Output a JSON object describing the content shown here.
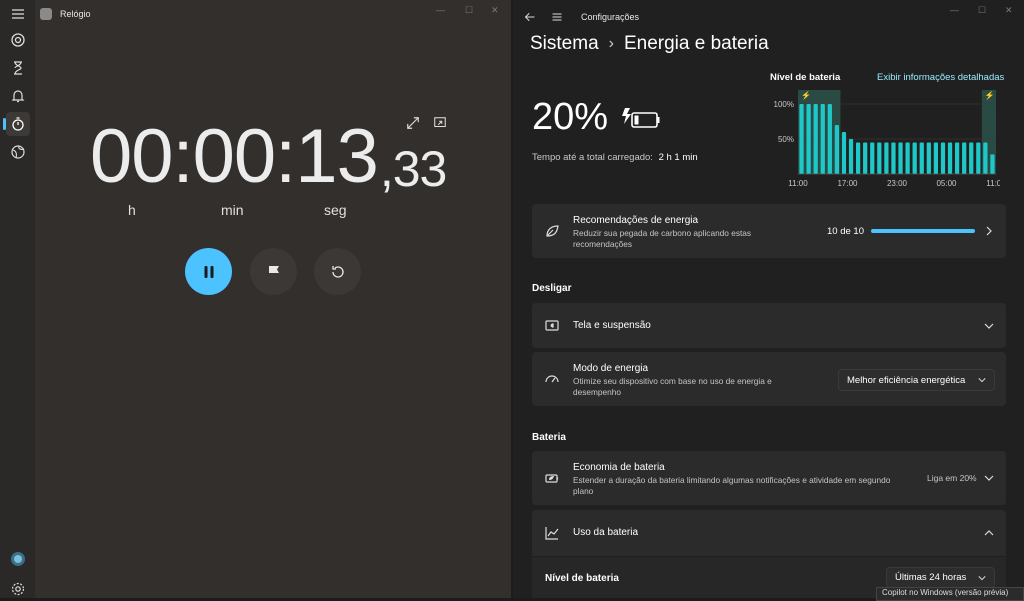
{
  "clock": {
    "title": "Relógio",
    "timer": {
      "main": "00:00:13",
      "centiseconds": ",33"
    },
    "units": {
      "hours": "h",
      "minutes": "min",
      "seconds": "seg"
    },
    "nav_icons": [
      "menu-icon",
      "focus-icon",
      "timer-icon",
      "alarm-icon",
      "stopwatch-icon",
      "world-clock-icon",
      "avatar-icon",
      "settings-icon"
    ]
  },
  "settings": {
    "title": "Configurações",
    "breadcrumb": {
      "parent": "Sistema",
      "current": "Energia e bateria"
    },
    "battery": {
      "percent": "20%",
      "time_full_label": "Tempo até a total carregado:",
      "time_full_value": "2 h 1 min"
    },
    "level_panel": {
      "title": "Nível de bateria",
      "details_link": "Exibir informações detalhadas"
    },
    "recommendations": {
      "title": "Recomendações de energia",
      "desc": "Reduzir sua pegada de carbono aplicando estas recomendações",
      "count": "10 de 10",
      "progress": 1.0
    },
    "desligar": {
      "header": "Desligar",
      "screen_sleep": "Tela e suspensão",
      "power_mode_title": "Modo de energia",
      "power_mode_desc": "Otimize seu dispositivo com base no uso de energia e desempenho",
      "power_mode_value": "Melhor eficiência energética"
    },
    "bateria": {
      "header": "Bateria",
      "saver_title": "Economia de bateria",
      "saver_desc": "Estender a duração da bateria limitando algumas notificações e atividade em segundo plano",
      "saver_value": "Liga em 20%",
      "usage_title": "Uso da bateria",
      "level_label": "Nível de bateria",
      "level_range": "Últimas 24 horas"
    },
    "tooltip": "Copilot no Windows (versão prévia)"
  },
  "chart_data": {
    "type": "bar",
    "title": "Nível de bateria",
    "x_ticks": [
      "11:00",
      "17:00",
      "23:00",
      "05:00",
      "11:00"
    ],
    "y_ticks": [
      "100%",
      "50%"
    ],
    "ylim": [
      0,
      100
    ],
    "values": [
      100,
      100,
      100,
      100,
      100,
      70,
      60,
      50,
      45,
      45,
      45,
      45,
      45,
      45,
      45,
      45,
      45,
      45,
      45,
      45,
      45,
      45,
      45,
      45,
      45,
      45,
      45,
      28
    ],
    "charging_zones": [
      [
        0,
        5
      ],
      [
        26,
        27
      ]
    ],
    "colors": {
      "bar": "#1fc8c8",
      "charging": "#2a4a44"
    }
  }
}
